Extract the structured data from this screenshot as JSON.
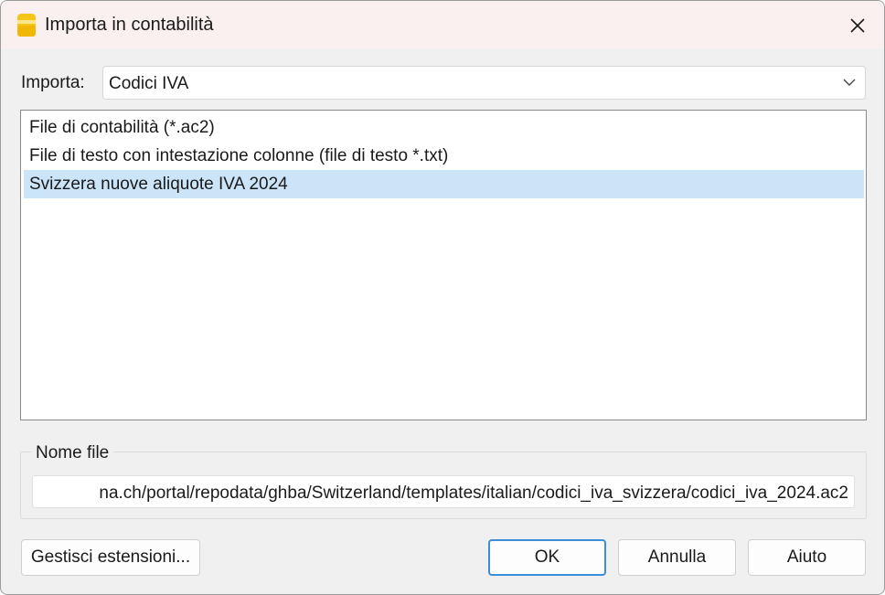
{
  "window": {
    "title": "Importa in contabilità",
    "icons": {
      "app": "banana-app-icon",
      "close": "close-icon"
    },
    "colors": {
      "titlebar": "#fbf0f0",
      "selection": "#cce4f7",
      "default_button_border": "#3a8fd6"
    }
  },
  "import": {
    "label": "Importa:",
    "selected": "Codici IVA"
  },
  "list": {
    "items": [
      {
        "label": "File di contabilità (*.ac2)",
        "selected": false
      },
      {
        "label": "File di testo con intestazione colonne (file di testo *.txt)",
        "selected": false
      },
      {
        "label": "Svizzera nuove aliquote IVA 2024",
        "selected": true
      }
    ]
  },
  "file": {
    "group_title": "Nome file",
    "value": "na.ch/portal/repodata/ghba/Switzerland/templates/italian/codici_iva_svizzera/codici_iva_2024.ac2"
  },
  "buttons": {
    "extensions": "Gestisci estensioni...",
    "ok": "OK",
    "cancel": "Annulla",
    "help": "Aiuto"
  }
}
